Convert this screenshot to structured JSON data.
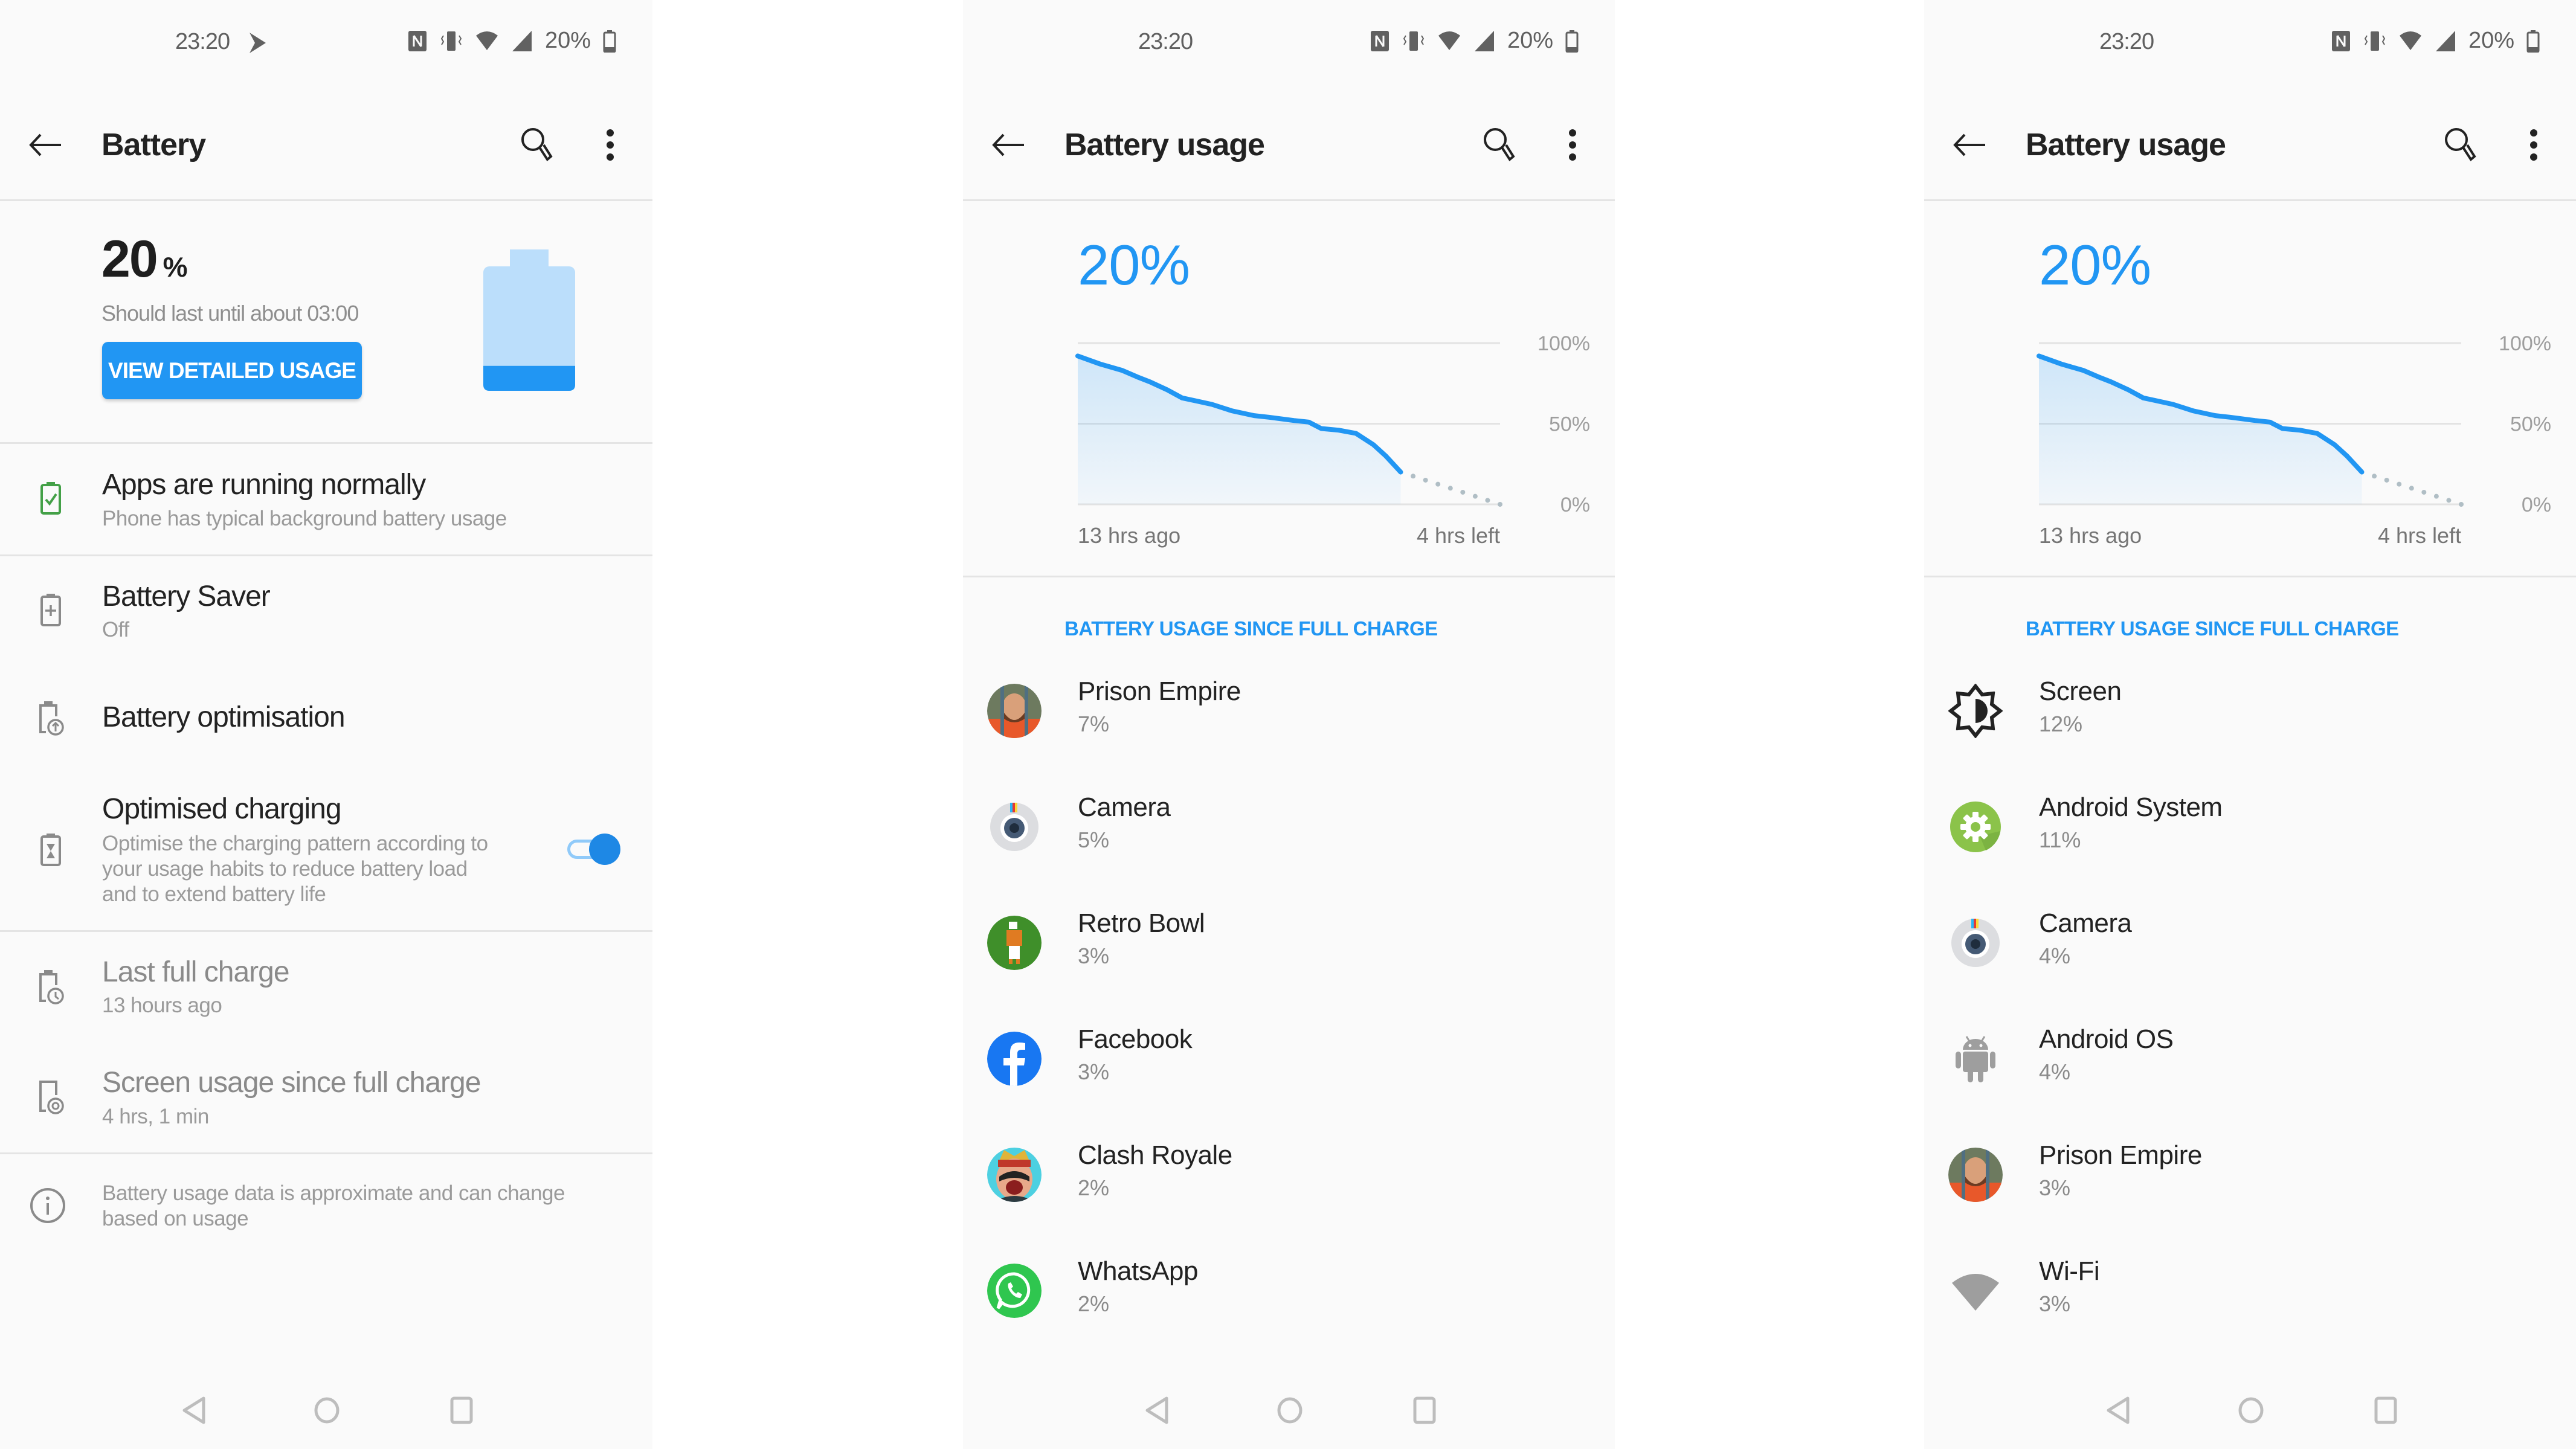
{
  "status_bar": {
    "time": "23:20",
    "battery_percent": "20%"
  },
  "screens": [
    {
      "toolbar": {
        "title": "Battery"
      },
      "summary": {
        "percent_number": "20",
        "percent_unit": "%",
        "estimate": "Should last until about 03:00",
        "button_label": "VIEW DETAILED USAGE",
        "battery_level": 0.2
      },
      "items": [
        {
          "title": "Apps are running normally",
          "subtitle": "Phone has typical background battery usage"
        },
        {
          "title": "Battery Saver",
          "subtitle": "Off"
        },
        {
          "title": "Battery optimisation"
        },
        {
          "title": "Optimised charging",
          "subtitle_lines": [
            "Optimise the charging pattern according to",
            "your usage habits to reduce battery load",
            "and to extend battery life"
          ],
          "toggle_on": true
        },
        {
          "title": "Last full charge",
          "subtitle": "13 hours ago"
        },
        {
          "title": "Screen usage since full charge",
          "subtitle": "4 hrs, 1 min"
        }
      ],
      "info_lines": [
        "Battery usage data is approximate and can change",
        "based on usage"
      ]
    },
    {
      "toolbar": {
        "title": "Battery usage"
      },
      "percent": "20%",
      "section_header": "BATTERY USAGE SINCE FULL CHARGE",
      "apps": [
        {
          "name": "Prison Empire",
          "percent": "7%",
          "icon": "prison-empire-icon"
        },
        {
          "name": "Camera",
          "percent": "5%",
          "icon": "camera-icon"
        },
        {
          "name": "Retro Bowl",
          "percent": "3%",
          "icon": "retro-bowl-icon"
        },
        {
          "name": "Facebook",
          "percent": "3%",
          "icon": "facebook-icon"
        },
        {
          "name": "Clash Royale",
          "percent": "2%",
          "icon": "clash-royale-icon"
        },
        {
          "name": "WhatsApp",
          "percent": "2%",
          "icon": "whatsapp-icon"
        }
      ]
    },
    {
      "toolbar": {
        "title": "Battery usage"
      },
      "percent": "20%",
      "section_header": "BATTERY USAGE SINCE FULL CHARGE",
      "apps": [
        {
          "name": "Screen",
          "percent": "12%",
          "icon": "brightness-icon"
        },
        {
          "name": "Android System",
          "percent": "11%",
          "icon": "android-system-gear-icon"
        },
        {
          "name": "Camera",
          "percent": "4%",
          "icon": "camera-icon"
        },
        {
          "name": "Android OS",
          "percent": "4%",
          "icon": "android-robot-icon"
        },
        {
          "name": "Prison Empire",
          "percent": "3%",
          "icon": "prison-empire-icon"
        },
        {
          "name": "Wi-Fi",
          "percent": "3%",
          "icon": "wifi-icon"
        }
      ]
    }
  ],
  "colors": {
    "accent": "#2196f3",
    "accent_light": "#bbdefb",
    "ok_green": "#43a047",
    "projection_dots": "#b0bec5"
  },
  "chart_data": {
    "type": "line",
    "title": "",
    "xlabel": "",
    "ylabel": "",
    "x_unit": "hours since last full charge",
    "xlim": [
      0,
      17
    ],
    "ylim": [
      0,
      100
    ],
    "y_ticks": [
      "100%",
      "50%",
      "0%"
    ],
    "y_tick_values": [
      100,
      50,
      0
    ],
    "x_tick_labels": [
      "13 hrs ago",
      "4 hrs left"
    ],
    "grid": true,
    "series": [
      {
        "name": "Battery level",
        "style": "solid",
        "x": [
          0,
          0.9,
          1.8,
          2.4,
          2.9,
          3.6,
          4.2,
          4.8,
          5.4,
          6.2,
          7.1,
          7.7,
          8.7,
          9.3,
          9.8,
          10.5,
          11.2,
          11.9,
          12.4,
          13
        ],
        "y": [
          92,
          87,
          83,
          79,
          76,
          71,
          66,
          64,
          62,
          58,
          55,
          54,
          52,
          51,
          47,
          46,
          44,
          37,
          30,
          20
        ]
      },
      {
        "name": "Projected",
        "style": "dotted",
        "x": [
          13,
          17
        ],
        "y": [
          20,
          0
        ]
      }
    ]
  }
}
